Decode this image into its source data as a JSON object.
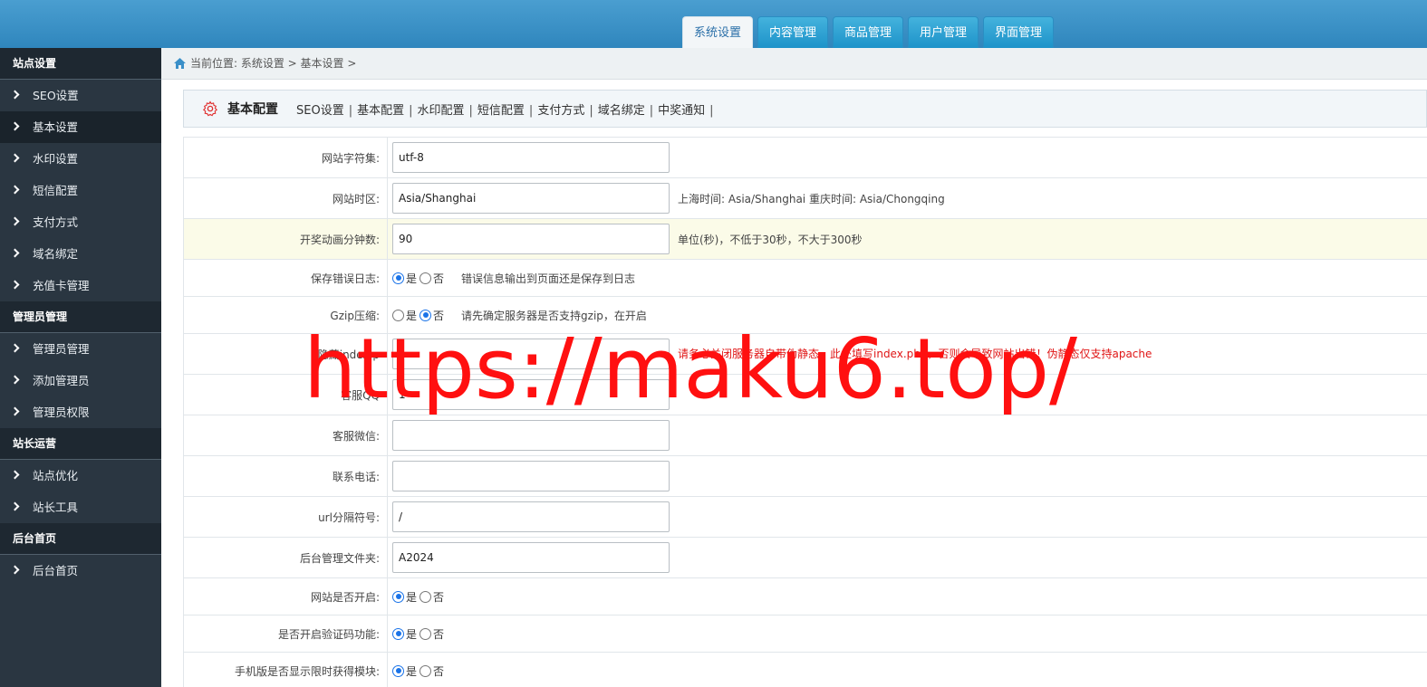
{
  "top_tabs": [
    "系统设置",
    "内容管理",
    "商品管理",
    "用户管理",
    "界面管理"
  ],
  "sidebar": {
    "groups": [
      {
        "title": "站点设置",
        "items": [
          "SEO设置",
          "基本设置",
          "水印设置",
          "短信配置",
          "支付方式",
          "域名绑定",
          "充值卡管理"
        ]
      },
      {
        "title": "管理员管理",
        "items": [
          "管理员管理",
          "添加管理员",
          "管理员权限"
        ]
      },
      {
        "title": "站长运营",
        "items": [
          "站点优化",
          "站长工具"
        ]
      },
      {
        "title": "后台首页",
        "items": [
          "后台首页"
        ]
      }
    ]
  },
  "breadcrumb": "当前位置: 系统设置 > 基本设置 >",
  "panel": {
    "title": "基本配置",
    "links": [
      "SEO设置",
      "基本配置",
      "水印配置",
      "短信配置",
      "支付方式",
      "域名绑定",
      "中奖通知"
    ]
  },
  "form": {
    "charset": {
      "label": "网站字符集:",
      "value": "utf-8"
    },
    "timezone": {
      "label": "网站时区:",
      "value": "Asia/Shanghai",
      "hint": "上海时间: Asia/Shanghai 重庆时间: Asia/Chongqing"
    },
    "anim": {
      "label": "开奖动画分钟数:",
      "value": "90",
      "hint": "单位(秒)，不低于30秒，不大于300秒"
    },
    "errlog": {
      "label": "保存错误日志:",
      "yes": "是",
      "no": "否",
      "hint": "错误信息输出到页面还是保存到日志"
    },
    "gzip": {
      "label": "Gzip压缩:",
      "yes": "是",
      "no": "否",
      "hint": "请先确定服务器是否支持gzip，在开启"
    },
    "hideindex": {
      "label": "隐藏index.p",
      "value": "",
      "hint": "请务必关闭服务器自带伪静态，此处填写index.php，否则会导致网站出错！伪静态仅支持apache"
    },
    "qq": {
      "label": "客服QQ",
      "value": "1"
    },
    "wechat": {
      "label": "客服微信:",
      "value": ""
    },
    "phone": {
      "label": "联系电话:",
      "value": ""
    },
    "urlsep": {
      "label": "url分隔符号:",
      "value": "/"
    },
    "admindir": {
      "label": "后台管理文件夹:",
      "value": "A2024"
    },
    "siteopen": {
      "label": "网站是否开启:",
      "yes": "是",
      "no": "否"
    },
    "captcha": {
      "label": "是否开启验证码功能:",
      "yes": "是",
      "no": "否"
    },
    "mobile": {
      "label": "手机版是否显示限时获得模块:",
      "yes": "是",
      "no": "否"
    }
  },
  "watermark": "https://maku6.top/",
  "colors": {
    "accent": "#1a73e8",
    "sidebar_bg": "#2a3641",
    "topbar": "#3a93c8",
    "hint_red": "#e01616"
  }
}
